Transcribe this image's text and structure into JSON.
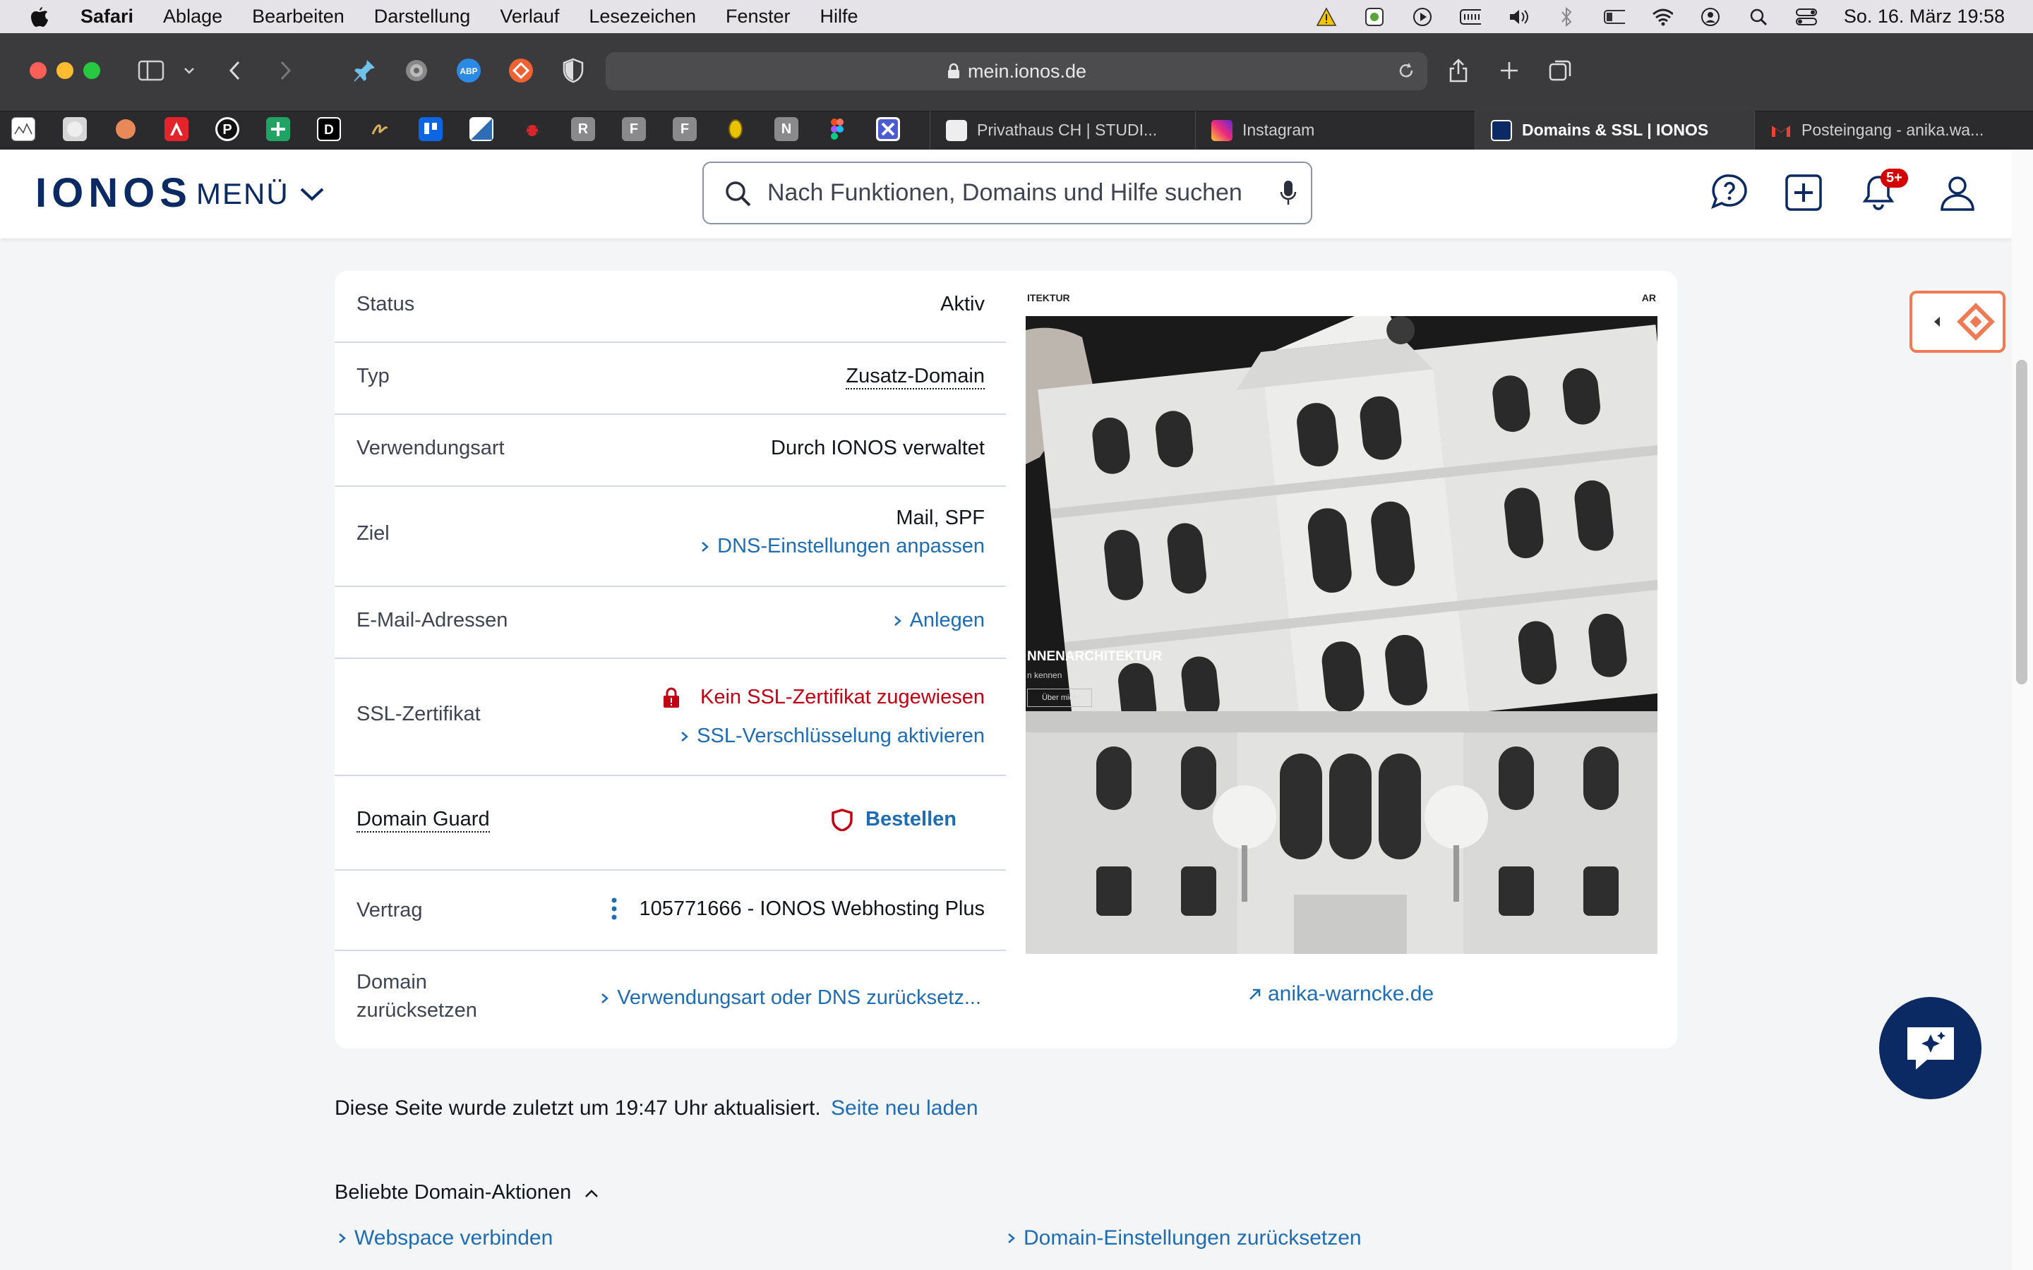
{
  "menubar": {
    "app": "Safari",
    "items": [
      "Ablage",
      "Bearbeiten",
      "Darstellung",
      "Verlauf",
      "Lesezeichen",
      "Fenster",
      "Hilfe"
    ],
    "clock": "So. 16. März  19:58"
  },
  "browser": {
    "url": "mein.ionos.de",
    "favorites": [
      "R",
      "F",
      "F",
      "N"
    ],
    "tabs": [
      {
        "label": "Privathaus CH | STUDI..."
      },
      {
        "label": "Instagram"
      },
      {
        "label": "Domains & SSL | IONOS"
      },
      {
        "label": "Posteingang - anika.wa..."
      }
    ]
  },
  "header": {
    "logo": "IONOS",
    "menu_label": "MENÜ",
    "search_placeholder": "Nach Funktionen, Domains und Hilfe suchen",
    "notification_badge": "5+"
  },
  "details": {
    "status_label": "Status",
    "status_value": "Aktiv",
    "typ_label": "Typ",
    "typ_value": "Zusatz-Domain",
    "usage_label": "Verwendungsart",
    "usage_value": "Durch IONOS verwaltet",
    "target_label": "Ziel",
    "target_value": "Mail, SPF",
    "target_link": "DNS-Einstellungen anpassen",
    "email_label": "E-Mail-Adressen",
    "email_link": "Anlegen",
    "ssl_label": "SSL-Zertifikat",
    "ssl_status": "Kein SSL-Zertifikat zugewiesen",
    "ssl_link": "SSL-Verschlüsselung aktivieren",
    "guard_label": "Domain Guard",
    "guard_link": "Bestellen",
    "contract_label": "Vertrag",
    "contract_value": "105771666 - IONOS Webhosting Plus",
    "reset_label_1": "Domain",
    "reset_label_2": "zurücksetzen",
    "reset_link": "Verwendungsart oder DNS zurücksetz..."
  },
  "preview": {
    "site_link": "anika-warncke.de",
    "header_left": "ITEKTUR",
    "header_right": "AR",
    "overlay_title": "NNENARCHITEKTUR",
    "overlay_sub": "n kennen",
    "overlay_button": "Über mich"
  },
  "footer": {
    "updated_text": "Diese Seite wurde zuletzt um 19:47 Uhr aktualisiert.",
    "reload_link": "Seite neu laden",
    "section_title": "Beliebte Domain-Aktionen",
    "action_1": "Webspace verbinden",
    "action_2": "Domain-Einstellungen zurücksetzen"
  },
  "colors": {
    "brand_navy": "#0b2a63",
    "link_blue": "#1e6db4",
    "error_red": "#c20014",
    "accent_orange": "#f07a54"
  }
}
